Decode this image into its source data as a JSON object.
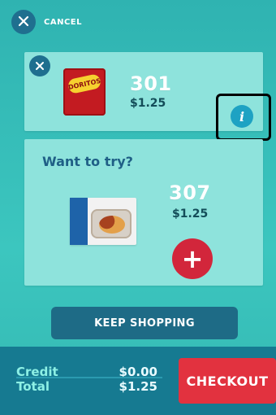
{
  "topbar": {
    "cancel_label": "CANCEL"
  },
  "cart_item": {
    "code": "301",
    "price": "$1.25",
    "brand_text": "DORITOS"
  },
  "suggestion": {
    "title": "Want to try?",
    "code": "307",
    "price": "$1.25"
  },
  "actions": {
    "keep_shopping": "KEEP SHOPPING",
    "checkout": "CHECKOUT"
  },
  "summary": {
    "credit_label": "Credit",
    "credit_value": "$0.00",
    "total_label": "Total",
    "total_value": "$1.25"
  },
  "icons": {
    "cancel": "close-icon",
    "remove": "close-icon",
    "info": "info-icon",
    "add": "plus-icon"
  },
  "colors": {
    "background": "#34b9b3",
    "card": "#8ee3dc",
    "primary_dark": "#1f6f8f",
    "accent_red": "#e2323f",
    "footer": "#167a91"
  }
}
